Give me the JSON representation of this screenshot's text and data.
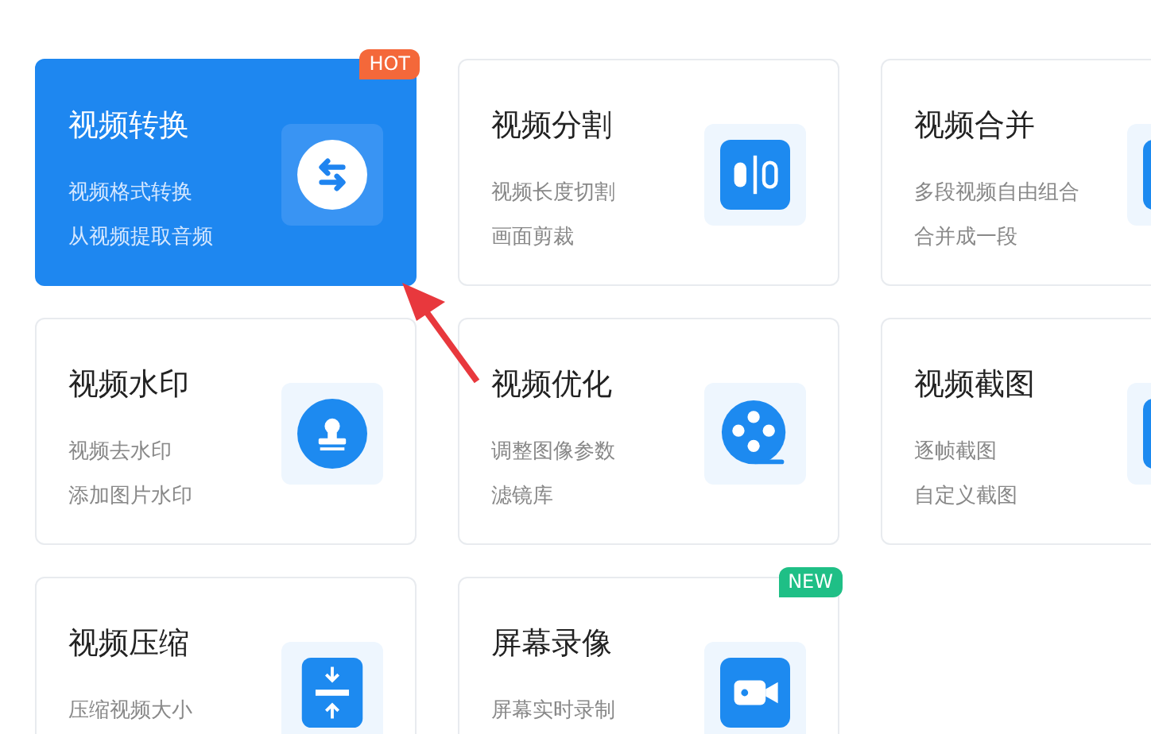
{
  "cards": [
    {
      "title": "视频转换",
      "lines": [
        "视频格式转换",
        "从视频提取音频"
      ],
      "selected": true,
      "badge": {
        "text": "HOT",
        "color": "#f4683a"
      }
    },
    {
      "title": "视频分割",
      "lines": [
        "视频长度切割",
        "画面剪裁"
      ],
      "selected": false
    },
    {
      "title": "视频合并",
      "lines": [
        "多段视频自由组合",
        "合并成一段"
      ],
      "selected": false
    },
    {
      "title": "视频水印",
      "lines": [
        "视频去水印",
        "添加图片水印"
      ],
      "selected": false
    },
    {
      "title": "视频优化",
      "lines": [
        "调整图像参数",
        "滤镜库"
      ],
      "selected": false
    },
    {
      "title": "视频截图",
      "lines": [
        "逐帧截图",
        "自定义截图"
      ],
      "selected": false
    },
    {
      "title": "视频压缩",
      "lines": [
        "压缩视频大小"
      ],
      "selected": false
    },
    {
      "title": "屏幕录像",
      "lines": [
        "屏幕实时录制"
      ],
      "selected": false,
      "badge": {
        "text": "NEW",
        "color": "#1fbf86"
      }
    }
  ]
}
